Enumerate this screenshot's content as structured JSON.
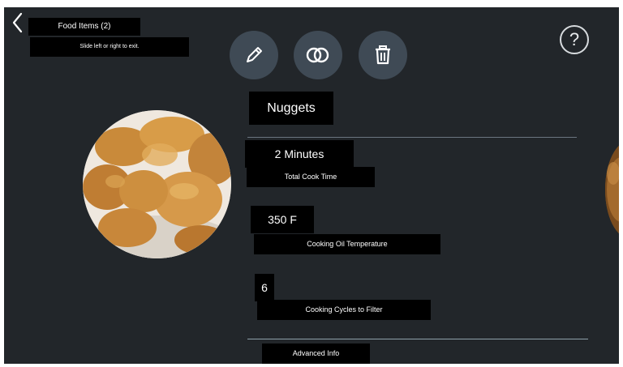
{
  "header": {
    "title": "Food Items (2)",
    "hint": "Slide left or right to exit.",
    "back_icon": "chevron-left-icon"
  },
  "toolbar": {
    "edit_icon": "pencil-icon",
    "compare_icon": "overlapping-circles-icon",
    "delete_icon": "trash-icon",
    "help_label": "?"
  },
  "item": {
    "name": "Nuggets",
    "cook_time_value": "2 Minutes",
    "cook_time_label": "Total Cook Time",
    "oil_temp_value": "350 F",
    "oil_temp_label": "Cooking Oil Temperature",
    "filter_cycles_value": "6",
    "filter_cycles_label": "Cooking Cycles to Filter",
    "advanced_label": "Advanced Info"
  },
  "colors": {
    "background": "#22262a",
    "button": "#3f4a55",
    "label_box": "#000000",
    "divider": "#6b7580"
  }
}
